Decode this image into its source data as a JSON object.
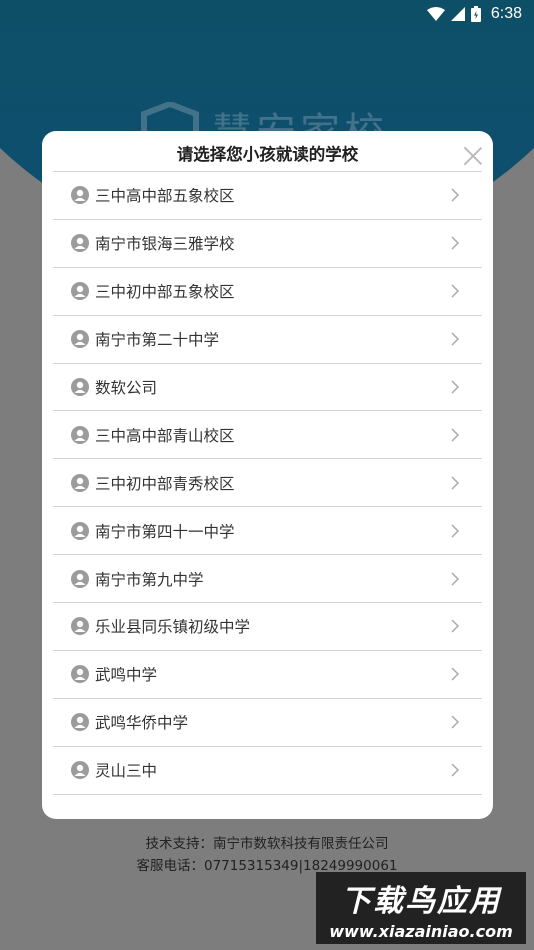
{
  "status_bar": {
    "time": "6:38",
    "icons": [
      "wifi-icon",
      "signal-icon",
      "battery-icon"
    ]
  },
  "background": {
    "logo_text": "慧安家校"
  },
  "dialog": {
    "title": "请选择您小孩就读的学校",
    "close_icon": "close-icon",
    "schools": [
      {
        "label": "三中高中部五象校区"
      },
      {
        "label": "南宁市银海三雅学校"
      },
      {
        "label": "三中初中部五象校区"
      },
      {
        "label": "南宁市第二十中学"
      },
      {
        "label": "数软公司"
      },
      {
        "label": "三中高中部青山校区"
      },
      {
        "label": "三中初中部青秀校区"
      },
      {
        "label": "南宁市第四十一中学"
      },
      {
        "label": "南宁市第九中学"
      },
      {
        "label": "乐业县同乐镇初级中学"
      },
      {
        "label": "武鸣中学"
      },
      {
        "label": "武鸣华侨中学"
      },
      {
        "label": "灵山三中"
      }
    ]
  },
  "footer": {
    "support": "技术支持：南宁市数软科技有限责任公司",
    "phone": "客服电话：07715315349|18249990061"
  },
  "watermark": {
    "title": "下载鸟应用",
    "url": "www.xiazainiao.com"
  },
  "colors": {
    "header_teal": "#0f4f66",
    "dim_overlay": "#7d7d7d",
    "dialog_bg": "#ffffff"
  }
}
